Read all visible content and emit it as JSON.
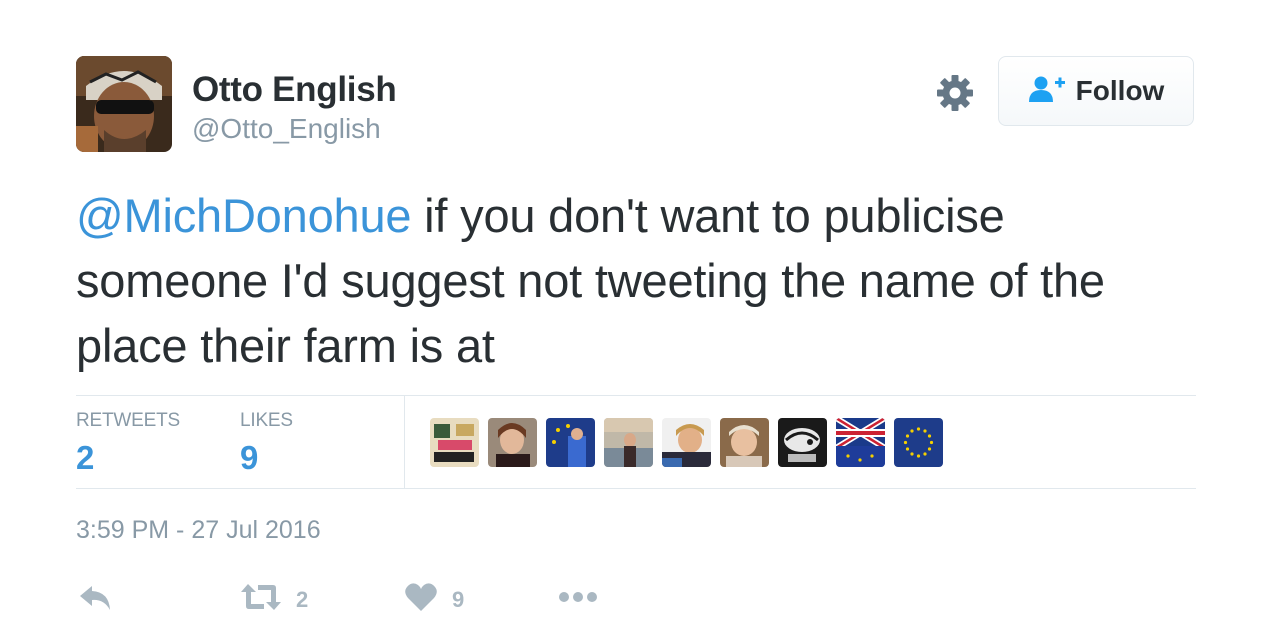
{
  "user": {
    "name": "Otto English",
    "handle": "@Otto_English",
    "avatar_icon": "profile-photo"
  },
  "header": {
    "settings_icon": "gear-icon",
    "follow_label": "Follow",
    "follow_icon": "add-user-icon"
  },
  "tweet": {
    "mention": "@MichDonohue",
    "body": " if you don't want to publicise someone I'd suggest not tweeting the name of the place their farm is at"
  },
  "stats": {
    "retweets_label": "RETWEETS",
    "retweets_count": "2",
    "likes_label": "LIKES",
    "likes_count": "9",
    "likers": [
      "liker-1",
      "liker-2",
      "liker-3",
      "liker-4",
      "liker-5",
      "liker-6",
      "liker-7",
      "liker-8",
      "liker-9"
    ]
  },
  "timestamp": "3:59 PM - 27 Jul 2016",
  "actions": {
    "reply_icon": "reply-icon",
    "retweet_icon": "retweet-icon",
    "retweet_count": "2",
    "like_icon": "heart-icon",
    "like_count": "9",
    "more_icon": "more-icon"
  },
  "colors": {
    "link": "#3b94d9",
    "text": "#292f33",
    "muted": "#8899a6",
    "action": "#aab8c2",
    "divider": "#e1e8ed"
  }
}
